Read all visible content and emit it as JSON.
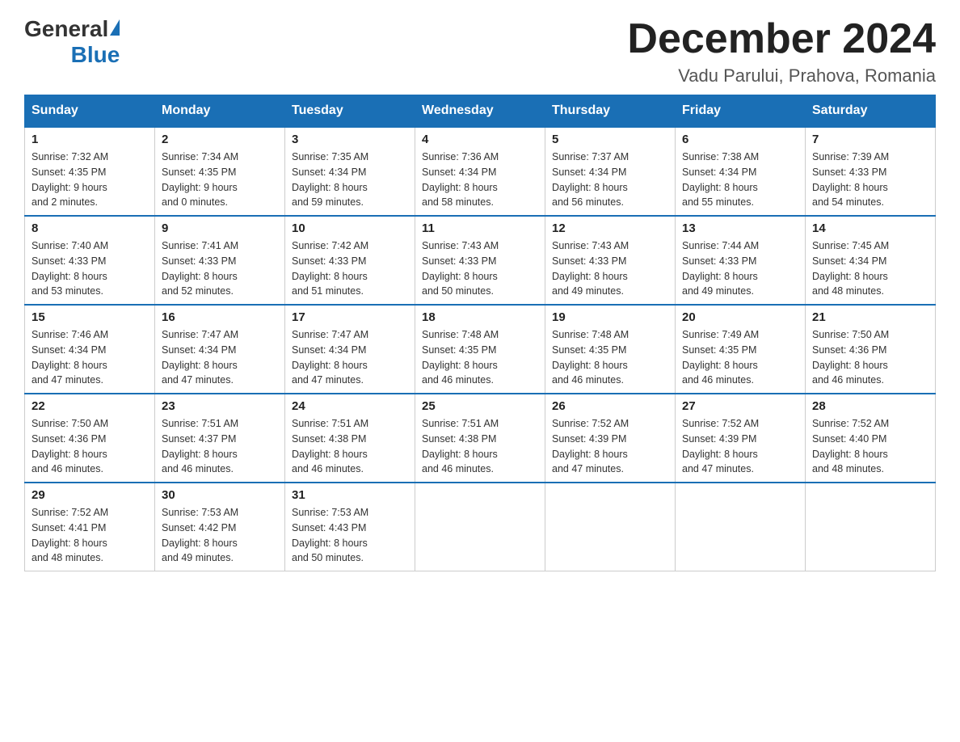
{
  "header": {
    "logo_general": "General",
    "logo_blue": "Blue",
    "month_title": "December 2024",
    "location": "Vadu Parului, Prahova, Romania"
  },
  "days_of_week": [
    "Sunday",
    "Monday",
    "Tuesday",
    "Wednesday",
    "Thursday",
    "Friday",
    "Saturday"
  ],
  "weeks": [
    [
      {
        "day": "1",
        "sunrise": "7:32 AM",
        "sunset": "4:35 PM",
        "daylight": "9 hours and 2 minutes."
      },
      {
        "day": "2",
        "sunrise": "7:34 AM",
        "sunset": "4:35 PM",
        "daylight": "9 hours and 0 minutes."
      },
      {
        "day": "3",
        "sunrise": "7:35 AM",
        "sunset": "4:34 PM",
        "daylight": "8 hours and 59 minutes."
      },
      {
        "day": "4",
        "sunrise": "7:36 AM",
        "sunset": "4:34 PM",
        "daylight": "8 hours and 58 minutes."
      },
      {
        "day": "5",
        "sunrise": "7:37 AM",
        "sunset": "4:34 PM",
        "daylight": "8 hours and 56 minutes."
      },
      {
        "day": "6",
        "sunrise": "7:38 AM",
        "sunset": "4:34 PM",
        "daylight": "8 hours and 55 minutes."
      },
      {
        "day": "7",
        "sunrise": "7:39 AM",
        "sunset": "4:33 PM",
        "daylight": "8 hours and 54 minutes."
      }
    ],
    [
      {
        "day": "8",
        "sunrise": "7:40 AM",
        "sunset": "4:33 PM",
        "daylight": "8 hours and 53 minutes."
      },
      {
        "day": "9",
        "sunrise": "7:41 AM",
        "sunset": "4:33 PM",
        "daylight": "8 hours and 52 minutes."
      },
      {
        "day": "10",
        "sunrise": "7:42 AM",
        "sunset": "4:33 PM",
        "daylight": "8 hours and 51 minutes."
      },
      {
        "day": "11",
        "sunrise": "7:43 AM",
        "sunset": "4:33 PM",
        "daylight": "8 hours and 50 minutes."
      },
      {
        "day": "12",
        "sunrise": "7:43 AM",
        "sunset": "4:33 PM",
        "daylight": "8 hours and 49 minutes."
      },
      {
        "day": "13",
        "sunrise": "7:44 AM",
        "sunset": "4:33 PM",
        "daylight": "8 hours and 49 minutes."
      },
      {
        "day": "14",
        "sunrise": "7:45 AM",
        "sunset": "4:34 PM",
        "daylight": "8 hours and 48 minutes."
      }
    ],
    [
      {
        "day": "15",
        "sunrise": "7:46 AM",
        "sunset": "4:34 PM",
        "daylight": "8 hours and 47 minutes."
      },
      {
        "day": "16",
        "sunrise": "7:47 AM",
        "sunset": "4:34 PM",
        "daylight": "8 hours and 47 minutes."
      },
      {
        "day": "17",
        "sunrise": "7:47 AM",
        "sunset": "4:34 PM",
        "daylight": "8 hours and 47 minutes."
      },
      {
        "day": "18",
        "sunrise": "7:48 AM",
        "sunset": "4:35 PM",
        "daylight": "8 hours and 46 minutes."
      },
      {
        "day": "19",
        "sunrise": "7:48 AM",
        "sunset": "4:35 PM",
        "daylight": "8 hours and 46 minutes."
      },
      {
        "day": "20",
        "sunrise": "7:49 AM",
        "sunset": "4:35 PM",
        "daylight": "8 hours and 46 minutes."
      },
      {
        "day": "21",
        "sunrise": "7:50 AM",
        "sunset": "4:36 PM",
        "daylight": "8 hours and 46 minutes."
      }
    ],
    [
      {
        "day": "22",
        "sunrise": "7:50 AM",
        "sunset": "4:36 PM",
        "daylight": "8 hours and 46 minutes."
      },
      {
        "day": "23",
        "sunrise": "7:51 AM",
        "sunset": "4:37 PM",
        "daylight": "8 hours and 46 minutes."
      },
      {
        "day": "24",
        "sunrise": "7:51 AM",
        "sunset": "4:38 PM",
        "daylight": "8 hours and 46 minutes."
      },
      {
        "day": "25",
        "sunrise": "7:51 AM",
        "sunset": "4:38 PM",
        "daylight": "8 hours and 46 minutes."
      },
      {
        "day": "26",
        "sunrise": "7:52 AM",
        "sunset": "4:39 PM",
        "daylight": "8 hours and 47 minutes."
      },
      {
        "day": "27",
        "sunrise": "7:52 AM",
        "sunset": "4:39 PM",
        "daylight": "8 hours and 47 minutes."
      },
      {
        "day": "28",
        "sunrise": "7:52 AM",
        "sunset": "4:40 PM",
        "daylight": "8 hours and 48 minutes."
      }
    ],
    [
      {
        "day": "29",
        "sunrise": "7:52 AM",
        "sunset": "4:41 PM",
        "daylight": "8 hours and 48 minutes."
      },
      {
        "day": "30",
        "sunrise": "7:53 AM",
        "sunset": "4:42 PM",
        "daylight": "8 hours and 49 minutes."
      },
      {
        "day": "31",
        "sunrise": "7:53 AM",
        "sunset": "4:43 PM",
        "daylight": "8 hours and 50 minutes."
      },
      null,
      null,
      null,
      null
    ]
  ]
}
